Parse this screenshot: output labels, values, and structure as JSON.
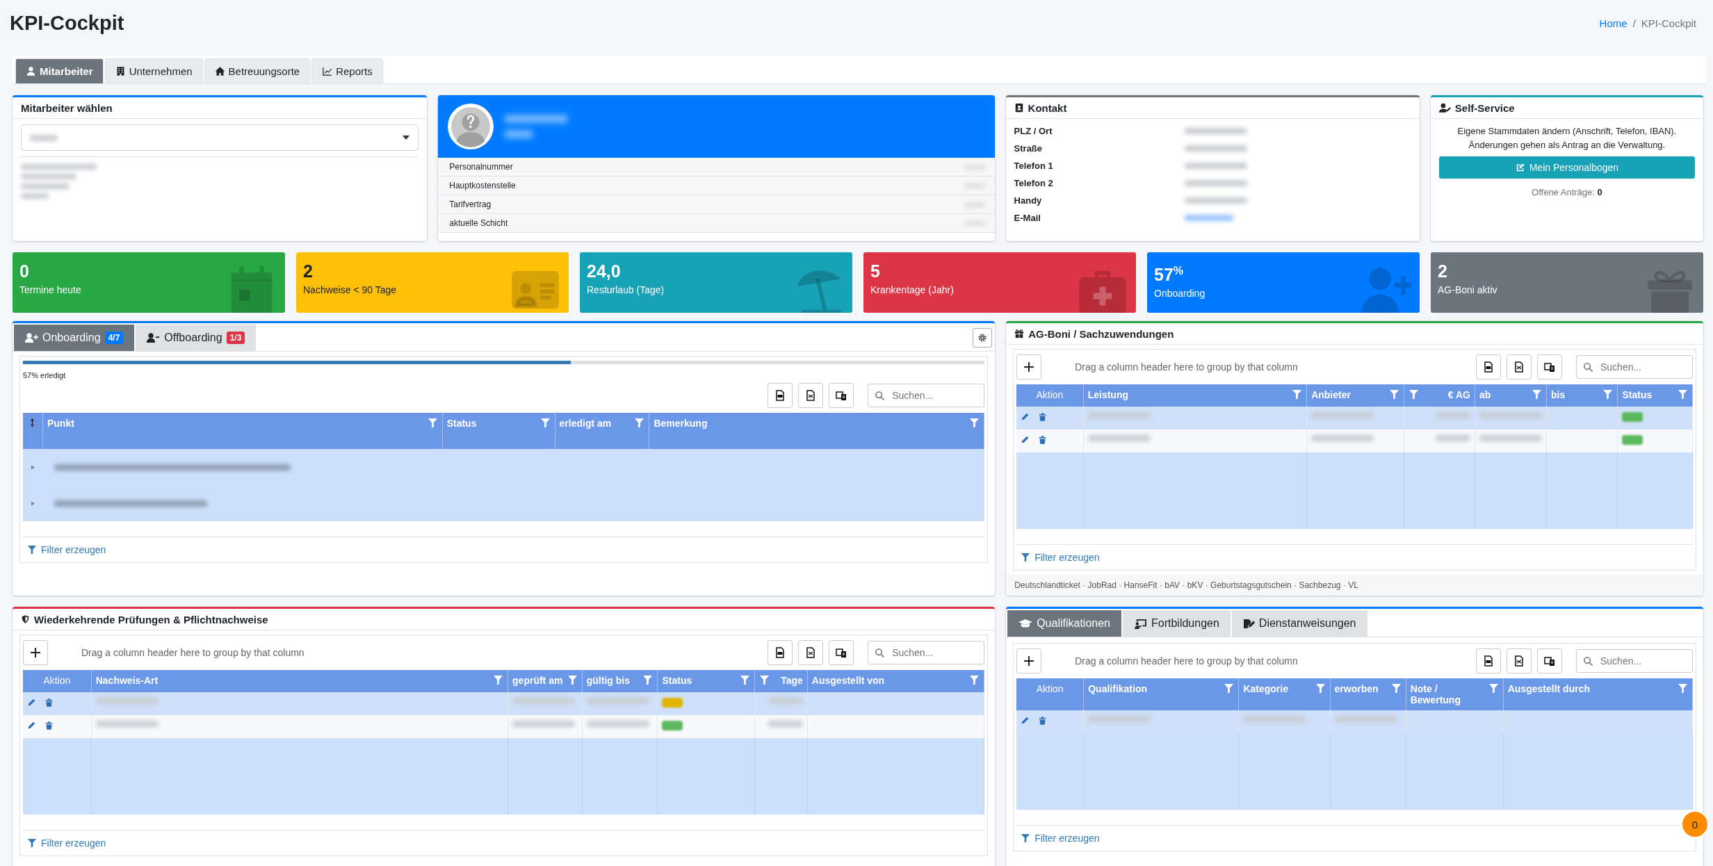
{
  "page": {
    "title": "KPI-Cockpit",
    "breadcrumb": [
      {
        "label": "Home",
        "kind": "link"
      },
      {
        "label": "/",
        "kind": "separator"
      },
      {
        "label": "KPI-Cockpit",
        "kind": "current"
      }
    ]
  },
  "main_tabs": [
    {
      "label": "Mitarbeiter",
      "kind": "user",
      "selected": true
    },
    {
      "label": "Unternehmen",
      "kind": "building",
      "selected": false
    },
    {
      "label": "Betreuungsorte",
      "kind": "house",
      "selected": false
    },
    {
      "label": "Reports",
      "kind": "chart",
      "selected": false
    }
  ],
  "employee_select": {
    "title": "Mitarbeiter wählen"
  },
  "profile": {
    "fields": [
      {
        "label": "Personalnummer"
      },
      {
        "label": "Hauptkostenstelle"
      },
      {
        "label": "Tarifvertrag"
      },
      {
        "label": "aktuelle Schicht"
      }
    ]
  },
  "contact": {
    "title": "Kontakt",
    "fields": [
      {
        "label": "PLZ / Ort",
        "kind": "text"
      },
      {
        "label": "Straße",
        "kind": "text"
      },
      {
        "label": "Telefon 1",
        "kind": "text"
      },
      {
        "label": "Telefon 2",
        "kind": "text"
      },
      {
        "label": "Handy",
        "kind": "text"
      },
      {
        "label": "E-Mail",
        "kind": "link"
      }
    ]
  },
  "self_service": {
    "title": "Self-Service",
    "description": [
      "Eigene Stammdaten ändern (Anschrift, Telefon, IBAN).",
      "Änderungen gehen als Antrag an die Verwaltung."
    ],
    "button": "Mein Personalbogen",
    "pending_label": "Offene Anträge:",
    "pending_count": "0"
  },
  "kpis": [
    {
      "value": "0",
      "label": "Termine heute",
      "kind": "calendar",
      "color": "#28a745"
    },
    {
      "value": "2",
      "label": "Nachweise < 90 Tage",
      "kind": "idcard",
      "color": "#ffc107"
    },
    {
      "value": "24,0",
      "label": "Resturlaub (Tage)",
      "kind": "umbrella",
      "color": "#17a2b8"
    },
    {
      "value": "5",
      "label": "Krankentage (Jahr)",
      "kind": "medkit",
      "color": "#dc3545"
    },
    {
      "value": "57$^{%}$",
      "label": "Onboarding",
      "kind": "userplus",
      "color": "#007bff"
    },
    {
      "value": "2",
      "label": "AG-Boni aktiv",
      "kind": "gift",
      "color": "#6c757d"
    }
  ],
  "onboarding": {
    "tabs": [
      {
        "label": "Onboarding",
        "kind": "add",
        "badge": "4/7",
        "color": "#007bff",
        "selected": true
      },
      {
        "label": "Offboarding",
        "kind": "remove",
        "badge": "1/3",
        "color": "#dc3545",
        "selected": false
      }
    ],
    "level": 0.57,
    "progress_label": "57% erledigt",
    "search_placeholder": "Suchen...",
    "columns": [
      "Punkt",
      "Status",
      "erledigt am",
      "Bemerkung"
    ],
    "groups": [
      {
        "expanded": false
      },
      {
        "expanded": false
      }
    ],
    "filter_label": "Filter erzeugen"
  },
  "bonuses": {
    "title": "AG-Boni / Sachzuwendungen",
    "group_hint": "Drag a column header here to group by that column",
    "search_placeholder": "Suchen...",
    "columns": [
      {
        "label": "Aktion",
        "kind": "actions"
      },
      {
        "label": "Leistung",
        "kind": "text"
      },
      {
        "label": "Anbieter",
        "kind": "text"
      },
      {
        "label": "€ AG",
        "kind": "number"
      },
      {
        "label": "ab",
        "kind": "text"
      },
      {
        "label": "bis",
        "kind": "blank"
      },
      {
        "label": "Status",
        "kind": "status"
      }
    ],
    "rows": [
      {
        "selected": true,
        "color": "#5cb85c"
      },
      {
        "selected": false,
        "color": "#5cb85c"
      }
    ],
    "filter_label": "Filter erzeugen",
    "footer": "Deutschlandticket · JobRad · HanseFit · bAV · bKV · Geburtstagsgutschein · Sachbezug · VL"
  },
  "checks": {
    "title": "Wiederkehrende Prüfungen & Pflichtnachweise",
    "group_hint": "Drag a column header here to group by that column",
    "search_placeholder": "Suchen...",
    "columns": [
      {
        "label": "Aktion",
        "kind": "actions"
      },
      {
        "label": "Nachweis-Art",
        "kind": "text"
      },
      {
        "label": "geprüft am",
        "kind": "text"
      },
      {
        "label": "gültig bis",
        "kind": "text"
      },
      {
        "label": "Status",
        "kind": "status"
      },
      {
        "label": "Tage",
        "kind": "number"
      },
      {
        "label": "Ausgestellt von",
        "kind": "blank"
      }
    ],
    "rows": [
      {
        "selected": true,
        "color": "#e0b400"
      },
      {
        "selected": false,
        "color": "#5cb85c"
      }
    ],
    "filter_label": "Filter erzeugen"
  },
  "qualifications": {
    "tabs": [
      {
        "label": "Qualifikationen",
        "kind": "cap",
        "selected": true
      },
      {
        "label": "Fortbildungen",
        "kind": "board",
        "selected": false
      },
      {
        "label": "Dienstanweisungen",
        "kind": "sign",
        "selected": false
      }
    ],
    "group_hint": "Drag a column header here to group by that column",
    "search_placeholder": "Suchen...",
    "columns": [
      {
        "label": "Aktion",
        "kind": "actions"
      },
      {
        "label": "Qualifikation",
        "kind": "text"
      },
      {
        "label": "Kategorie",
        "kind": "text"
      },
      {
        "label": "erworben",
        "kind": "text"
      },
      {
        "label": "Note / Bewertung",
        "kind": "blank"
      },
      {
        "label": "Ausgestellt durch",
        "kind": "blank"
      }
    ],
    "rows": [
      {
        "selected": true
      }
    ],
    "filter_label": "Filter erzeugen"
  },
  "notification_count": "0"
}
